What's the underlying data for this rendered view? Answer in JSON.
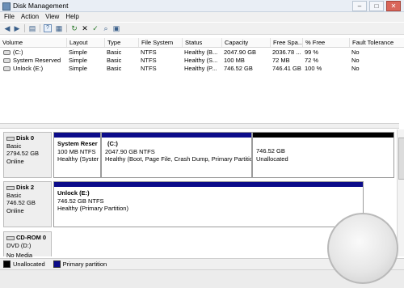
{
  "window": {
    "title": "Disk Management",
    "minimize": "–",
    "maximize": "□",
    "close": "✕"
  },
  "menu": [
    {
      "label": "File"
    },
    {
      "label": "Action"
    },
    {
      "label": "View"
    },
    {
      "label": "Help"
    }
  ],
  "toolbar": [
    {
      "icon": "back-arrow-icon",
      "glyph": "◀"
    },
    {
      "icon": "forward-arrow-icon",
      "glyph": "▶"
    },
    {
      "icon": "disk-list-icon",
      "glyph": "▤"
    },
    {
      "icon": "help-icon",
      "glyph": "?"
    },
    {
      "icon": "properties-icon",
      "glyph": "▦"
    },
    {
      "icon": "refresh-icon",
      "glyph": "↻"
    },
    {
      "icon": "delete-icon",
      "glyph": "✕"
    },
    {
      "icon": "checkmark-icon",
      "glyph": "✓"
    },
    {
      "icon": "search-disk-icon",
      "glyph": "⌕"
    },
    {
      "icon": "view-icon",
      "glyph": "▣"
    }
  ],
  "volumes": {
    "columns": [
      "Volume",
      "Layout",
      "Type",
      "File System",
      "Status",
      "Capacity",
      "Free Spa...",
      "% Free",
      "Fault Tolerance"
    ],
    "rows": [
      {
        "volume": "(C:)",
        "layout": "Simple",
        "type": "Basic",
        "fs": "NTFS",
        "status": "Healthy (B...",
        "capacity": "2047.90 GB",
        "free": "2036.78 ...",
        "pct": "99 %",
        "fault": "No"
      },
      {
        "volume": "System Reserved",
        "layout": "Simple",
        "type": "Basic",
        "fs": "NTFS",
        "status": "Healthy (S...",
        "capacity": "100 MB",
        "free": "72 MB",
        "pct": "72 %",
        "fault": "No"
      },
      {
        "volume": "Unlock (E:)",
        "layout": "Simple",
        "type": "Basic",
        "fs": "NTFS",
        "status": "Healthy (P...",
        "capacity": "746.52 GB",
        "free": "746.41 GB",
        "pct": "100 %",
        "fault": "No"
      }
    ]
  },
  "disks": {
    "disk0": {
      "name": "Disk 0",
      "type": "Basic",
      "size": "2794.52 GB",
      "state": "Online",
      "parts": [
        {
          "name": "System Reser",
          "size": "100 MB NTFS",
          "status": "Healthy (Syster"
        },
        {
          "name": "(C:)",
          "size": "2047.90 GB NTFS",
          "status": "Healthy (Boot, Page File, Crash Dump, Primary Partitio"
        },
        {
          "name": "",
          "size": "746.52 GB",
          "status": "Unallocated"
        }
      ]
    },
    "disk2": {
      "name": "Disk 2",
      "type": "Basic",
      "size": "746.52 GB",
      "state": "Online",
      "parts": [
        {
          "name": "Unlock (E:)",
          "size": "746.52 GB NTFS",
          "status": "Healthy (Primary Partition)"
        }
      ]
    },
    "cdrom": {
      "name": "CD-ROM 0",
      "type": "DVD (D:)",
      "media": "No Media"
    }
  },
  "legend": [
    {
      "label": "Unallocated",
      "color": "#000000"
    },
    {
      "label": "Primary partition",
      "color": "#0c0c8a"
    }
  ]
}
